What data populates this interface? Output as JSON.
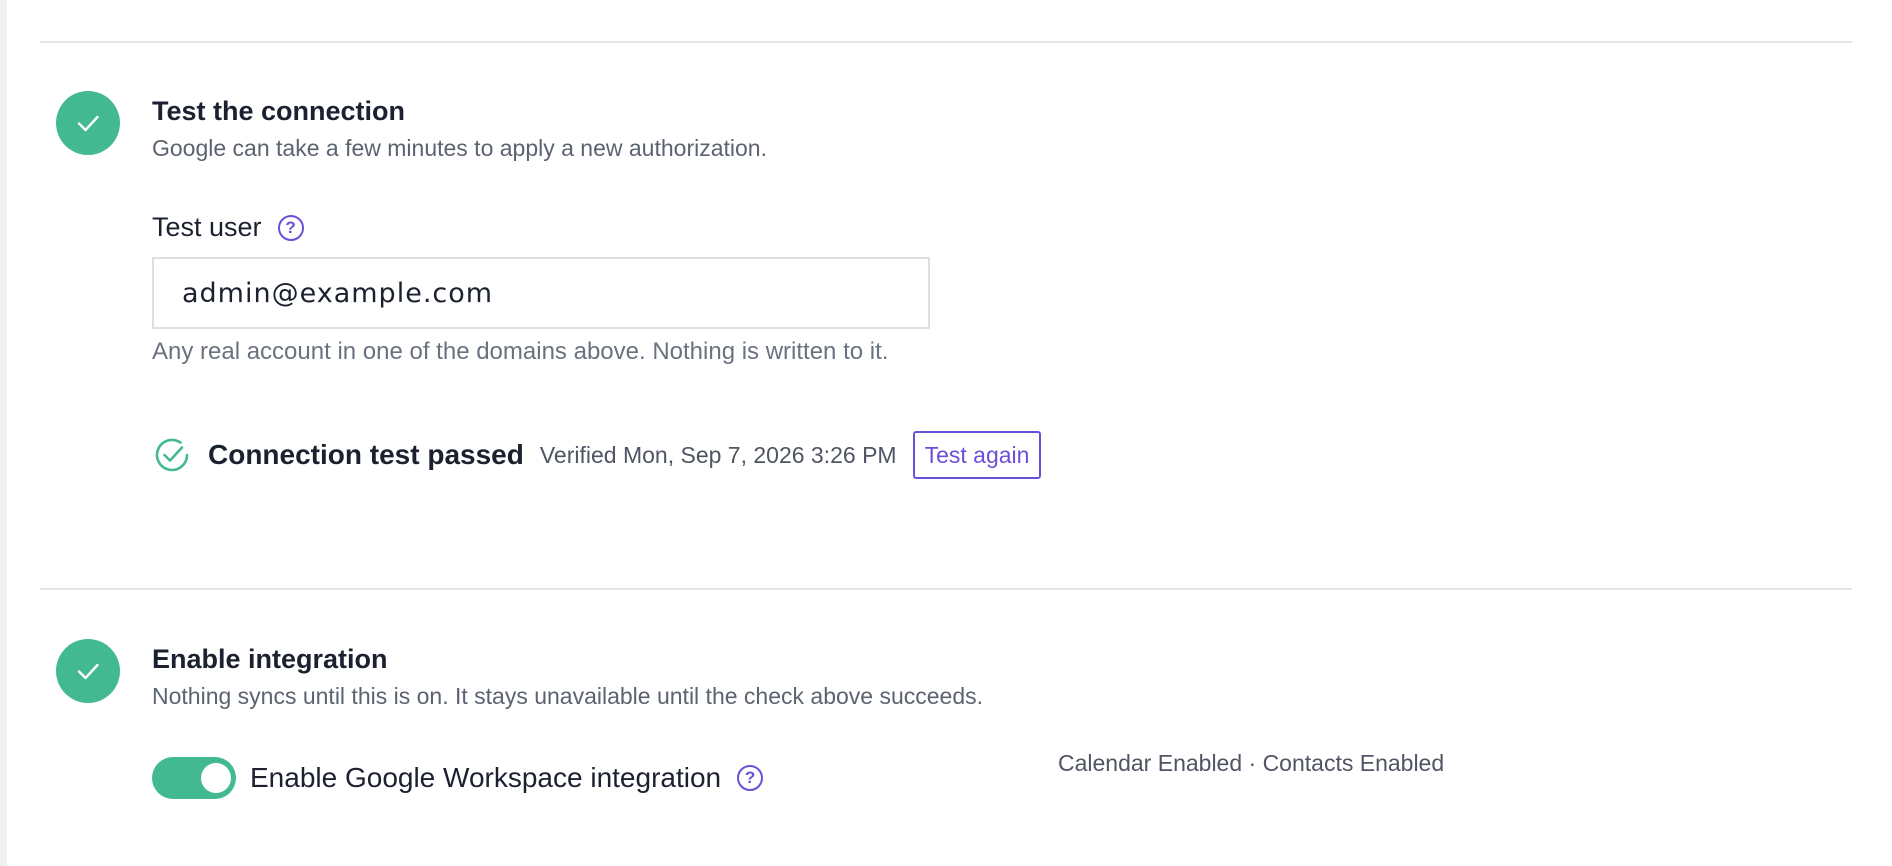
{
  "colors": {
    "success": "#43b991",
    "accent": "#6c4fd8",
    "divider": "#e3e5e8"
  },
  "test_connection": {
    "icon": "check-icon",
    "title": "Test the connection",
    "description": "Google can take a few minutes to apply a new authorization.",
    "test_user": {
      "label": "Test user",
      "help_icon": "question-circle-icon",
      "help_glyph": "?",
      "value": "admin@example.com",
      "hint": "Any real account in one of the domains above. Nothing is written to it."
    },
    "result": {
      "icon": "check-circle-icon",
      "title": "Connection test passed",
      "verified": "Verified Mon, Sep 7, 2026 3:26 PM",
      "button_label": "Test again"
    }
  },
  "enable_integration": {
    "icon": "check-icon",
    "title": "Enable integration",
    "description": "Nothing syncs until this is on. It stays unavailable until the check above succeeds.",
    "toggle": {
      "on": true,
      "label": "Enable Google Workspace integration",
      "help_icon": "question-circle-icon",
      "help_glyph": "?"
    },
    "services_status": "Calendar Enabled · Contacts Enabled"
  }
}
